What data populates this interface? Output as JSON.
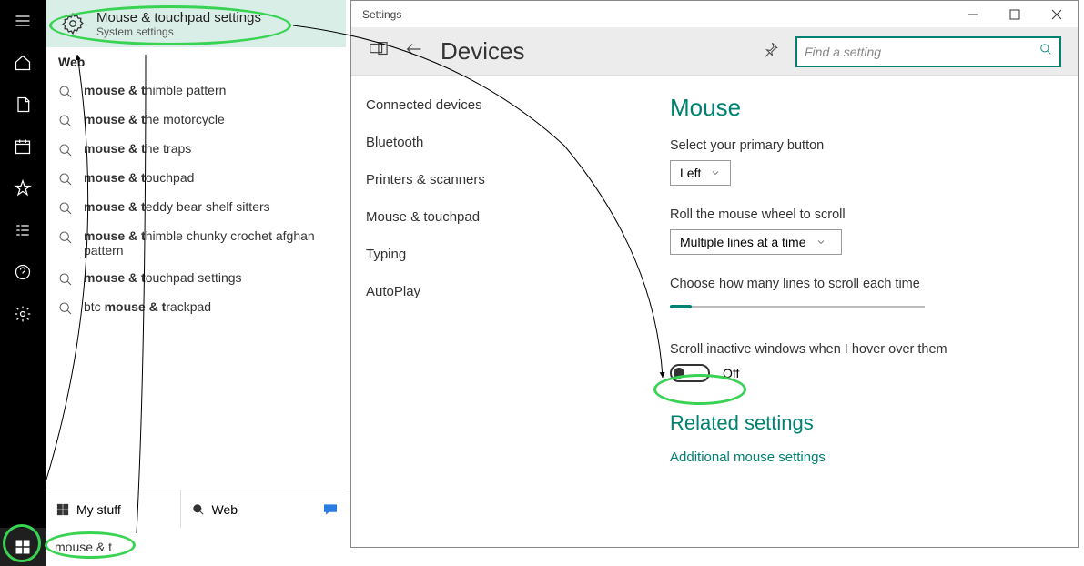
{
  "search": {
    "top_result": {
      "title": "Mouse & touchpad settings",
      "subtitle": "System settings"
    },
    "web_header": "Web",
    "suggestions": [
      {
        "prefix": "mouse & t",
        "suffix": "himble pattern"
      },
      {
        "prefix": "mouse & t",
        "suffix": "he motorcycle"
      },
      {
        "prefix": "mouse & t",
        "suffix": "he traps"
      },
      {
        "prefix": "mouse & t",
        "suffix": "ouchpad"
      },
      {
        "prefix": "mouse & t",
        "suffix": "eddy bear shelf sitters"
      },
      {
        "prefix": "mouse & t",
        "suffix": "himble chunky crochet afghan pattern"
      },
      {
        "prefix": "mouse & t",
        "suffix": "ouchpad settings"
      },
      {
        "prefix_plain": "btc ",
        "prefix": "mouse & t",
        "suffix": "rackpad"
      }
    ],
    "tabs": {
      "my_stuff": "My stuff",
      "web": "Web"
    },
    "input_value": "mouse & t"
  },
  "settings": {
    "window_title": "Settings",
    "header_title": "Devices",
    "find_placeholder": "Find a setting",
    "categories": [
      "Connected devices",
      "Bluetooth",
      "Printers & scanners",
      "Mouse & touchpad",
      "Typing",
      "AutoPlay"
    ],
    "page_title": "Mouse",
    "primary_button_label": "Select your primary button",
    "primary_button_value": "Left",
    "wheel_label": "Roll the mouse wheel to scroll",
    "wheel_value": "Multiple lines at a time",
    "lines_label": "Choose how many lines to scroll each time",
    "inactive_label": "Scroll inactive windows when I hover over them",
    "inactive_value": "Off",
    "related_title": "Related settings",
    "related_link": "Additional mouse settings"
  }
}
